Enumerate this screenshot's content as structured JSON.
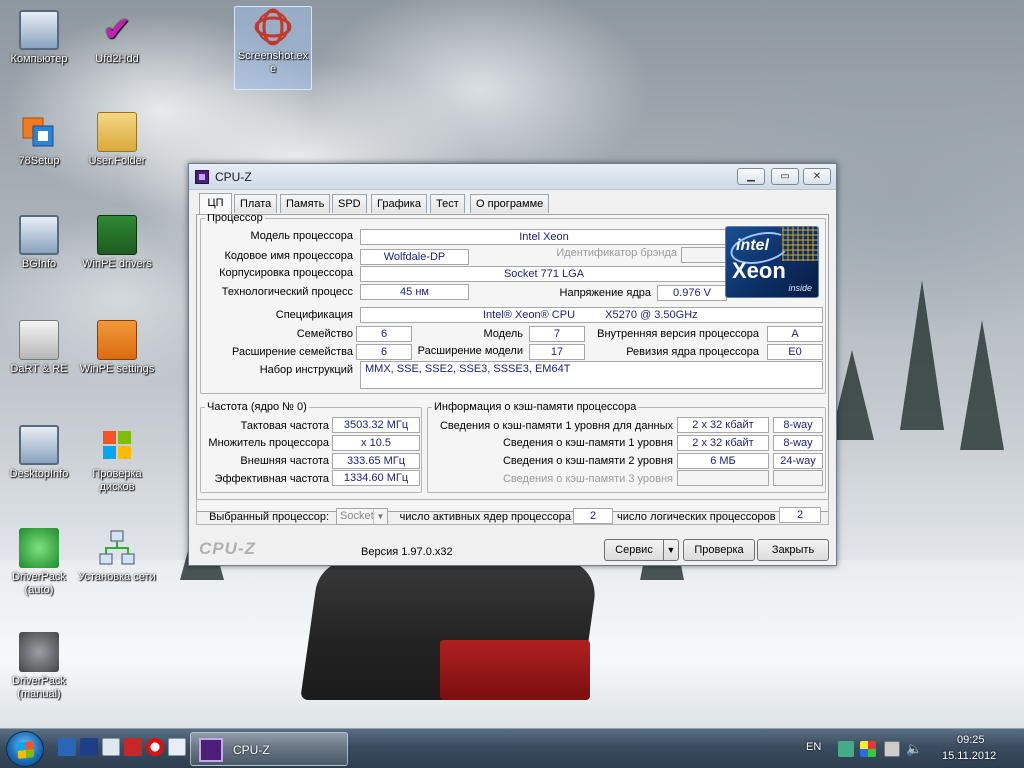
{
  "desktop": {
    "icons": [
      {
        "label": "Компьютер"
      },
      {
        "label": "Ufd2Hdd"
      },
      {
        "label": "Screenshot.exe"
      },
      {
        "label": "78Setup"
      },
      {
        "label": "User.Folder"
      },
      {
        "label": "BGInfo"
      },
      {
        "label": "WinPE drivers"
      },
      {
        "label": "DaRT & RE"
      },
      {
        "label": "WinPE settings"
      },
      {
        "label": "DesktopInfo"
      },
      {
        "label": "Проверка дисков"
      },
      {
        "label": "DriverPack (auto)"
      },
      {
        "label": "Установка сети"
      },
      {
        "label": "DriverPack (manual)"
      }
    ]
  },
  "window": {
    "title": "CPU-Z",
    "tabs": [
      "ЦП",
      "Плата",
      "Память",
      "SPD",
      "Графика",
      "Тест",
      "О программе"
    ],
    "active_tab": "ЦП",
    "processor": {
      "legend": "Процессор",
      "name_label": "Модель процессора",
      "name": "Intel Xeon",
      "codename_label": "Кодовое имя процессора",
      "codename": "Wolfdale-DP",
      "brand_id_label": "Идентификатор брэнда",
      "brand_id": "",
      "package_label": "Корпусировка процессора",
      "package": "Socket 771 LGA",
      "technology_label": "Технологический процесс",
      "technology": "45 нм",
      "voltage_label": "Напряжение ядра",
      "voltage": "0.976 V",
      "spec_label": "Спецификация",
      "spec_brand": "Intel® Xeon® CPU",
      "spec_model": "X5270  @ 3.50GHz",
      "family_label": "Семейство",
      "family": "6",
      "model_label": "Модель",
      "model": "7",
      "stepping_label": "Внутренняя версия процессора",
      "stepping": "A",
      "ext_family_label": "Расширение семейства",
      "ext_family": "6",
      "ext_model_label": "Расширение модели",
      "ext_model": "17",
      "revision_label": "Ревизия ядра процессора",
      "revision": "E0",
      "instructions_label": "Набор инструкций",
      "instructions": "MMX, SSE, SSE2, SSE3, SSSE3, EM64T"
    },
    "logo": {
      "line1": "intel",
      "line2": "Xeon",
      "line3": "inside"
    },
    "clocks": {
      "legend": "Частота (ядро № 0)",
      "core_speed_label": "Тактовая частота",
      "core_speed": "3503.32 МГц",
      "multiplier_label": "Множитель процессора",
      "multiplier": "x 10.5",
      "bus_speed_label": "Внешняя частота",
      "bus_speed": "333.65 МГц",
      "rated_fsb_label": "Эффективная частота",
      "rated_fsb": "1334.60 МГц"
    },
    "cache": {
      "legend": "Информация о кэш-памяти процессора",
      "l1d_label": "Сведения о кэш-памяти 1 уровня для данных",
      "l1d_size": "2 x 32 кбайт",
      "l1d_way": "8-way",
      "l1i_label": "Сведения о кэш-памяти 1 уровня",
      "l1i_size": "2 x 32 кбайт",
      "l1i_way": "8-way",
      "l2_label": "Сведения о кэш-памяти 2 уровня",
      "l2_size": "6 МБ",
      "l2_way": "24-way",
      "l3_label": "Сведения о кэш-памяти 3 уровня",
      "l3_size": "",
      "l3_way": ""
    },
    "selection": {
      "label": "Выбранный процессор:",
      "value": "Socket",
      "cores_label": "число активных ядер процессора",
      "cores": "2",
      "threads_label": "число логических процессоров",
      "threads": "2"
    },
    "footer": {
      "brand": "CPU-Z",
      "version": "Версия 1.97.0.x32",
      "tools_button": "Сервис",
      "validate_button": "Проверка",
      "close_button": "Закрыть"
    }
  },
  "taskbar": {
    "task_label": "CPU-Z",
    "language": "EN",
    "time": "09:25",
    "date": "15.11.2012"
  }
}
